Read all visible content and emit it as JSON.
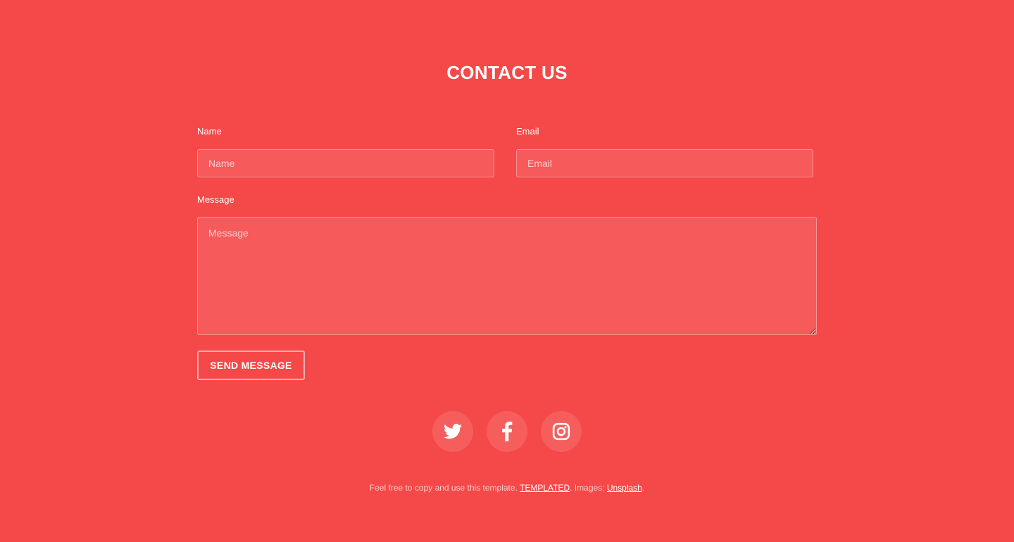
{
  "theme": {
    "background": "#f54848",
    "text": "#ffffff"
  },
  "contact": {
    "title": "CONTACT US",
    "name_label": "Name",
    "name_placeholder": "Name",
    "email_label": "Email",
    "email_placeholder": "Email",
    "message_label": "Message",
    "message_placeholder": "Message",
    "send_button": "SEND MESSAGE"
  },
  "social": {
    "icons": [
      "twitter-icon",
      "facebook-icon",
      "instagram-icon"
    ]
  },
  "footer": {
    "text_before": "Feel free to copy and use this template. ",
    "templated_link": "TEMPLATED",
    "text_middle": ". Images: ",
    "unsplash_link": "Unsplash",
    "text_after": "."
  }
}
